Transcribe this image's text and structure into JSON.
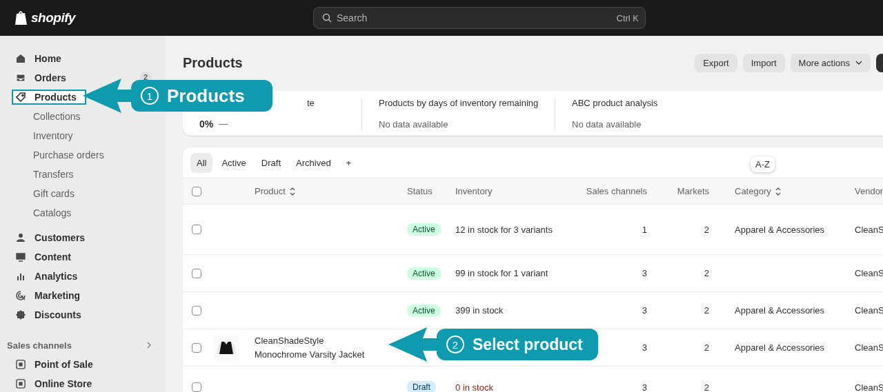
{
  "topbar": {
    "logo": "shopify",
    "search": {
      "placeholder": "Search",
      "shortcut": "Ctrl K"
    }
  },
  "sidebar": {
    "items": [
      {
        "label": "Home",
        "selected": false
      },
      {
        "label": "Orders",
        "selected": false,
        "badge": "2"
      },
      {
        "label": "Products",
        "selected": true,
        "children": [
          {
            "label": "Collections"
          },
          {
            "label": "Inventory"
          },
          {
            "label": "Purchase orders"
          },
          {
            "label": "Transfers"
          },
          {
            "label": "Gift cards"
          },
          {
            "label": "Catalogs"
          }
        ]
      },
      {
        "label": "Customers",
        "selected": false
      },
      {
        "label": "Content",
        "selected": false
      },
      {
        "label": "Analytics",
        "selected": false
      },
      {
        "label": "Marketing",
        "selected": false
      },
      {
        "label": "Discounts",
        "selected": false
      }
    ],
    "sales_channels": {
      "title": "Sales channels",
      "items": [
        {
          "label": "Point of Sale"
        },
        {
          "label": "Online Store"
        }
      ]
    }
  },
  "page": {
    "title": "Products",
    "actions": [
      {
        "label": "Export",
        "kind": "plain"
      },
      {
        "label": "Import",
        "kind": "plain"
      },
      {
        "label": "More actions",
        "kind": "menu"
      }
    ]
  },
  "metrics": [
    {
      "label": "te",
      "value": "0%",
      "trend": "—"
    },
    {
      "label": "Products by days of inventory remaining",
      "value": "No data available"
    },
    {
      "label": "ABC product analysis",
      "value": "No data available"
    }
  ],
  "tabs": [
    {
      "label": "All",
      "selected": true
    },
    {
      "label": "Active",
      "selected": false
    },
    {
      "label": "Draft",
      "selected": false
    },
    {
      "label": "Archived",
      "selected": false
    },
    {
      "label": "+",
      "selected": false
    }
  ],
  "tooltip": "A-Z",
  "table": {
    "all_checked": false,
    "columns": [
      {
        "label": "Product",
        "sortable": true
      },
      {
        "label": "Status",
        "sortable": false
      },
      {
        "label": "Inventory",
        "sortable": false
      },
      {
        "label": "Sales channels",
        "sortable": false
      },
      {
        "label": "Markets",
        "sortable": false
      },
      {
        "label": "Category",
        "sortable": true
      },
      {
        "label": "Vendor"
      }
    ],
    "rows": [
      {
        "checked": false,
        "status": {
          "label": "Active",
          "kind": "active"
        },
        "inventory": "12 in stock for 3 variants",
        "sales_channels": "1",
        "markets": "2",
        "category": "Apparel & Accessories",
        "vendor": "CleanS"
      },
      {
        "checked": false,
        "status": {
          "label": "Active",
          "kind": "active"
        },
        "inventory": "99 in stock for 1 variant",
        "sales_channels": "3",
        "markets": "2",
        "vendor": "CleanS"
      },
      {
        "checked": false,
        "status": {
          "label": "Active",
          "kind": "active"
        },
        "inventory": "399 in stock",
        "sales_channels": "3",
        "markets": "2",
        "category": "Apparel & Accessories",
        "vendor": "CleanS"
      },
      {
        "checked": false,
        "image": {
          "kind": "picture"
        },
        "product": [
          "CleanShadeStyle",
          "Monochrome Varsity Jacket"
        ],
        "sales_channels": "3",
        "markets": "2",
        "category": "Apparel & Accessories",
        "vendor": "CleanS"
      },
      {
        "checked": false,
        "status": {
          "label": "Draft",
          "kind": "draft"
        },
        "inventory": "0 in stock",
        "sales_channels": "3",
        "markets": "2",
        "vendor": "CleanS"
      }
    ]
  },
  "callouts": [
    {
      "number": "1",
      "label": "Products"
    },
    {
      "number": "2",
      "label": "Select product"
    }
  ]
}
